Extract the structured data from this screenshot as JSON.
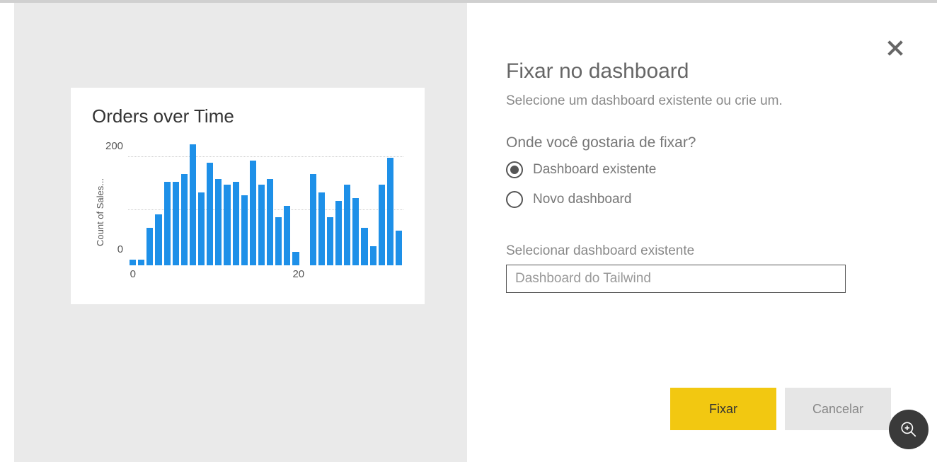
{
  "chart": {
    "title": "Orders over Time",
    "ylabel": "Count of Sales...",
    "yticks": [
      "200",
      "0"
    ],
    "xticks": [
      {
        "label": "0",
        "pos_pct": 2
      },
      {
        "label": "20",
        "pos_pct": 62
      }
    ]
  },
  "chart_data": {
    "type": "bar",
    "title": "Orders over Time",
    "xlabel": "",
    "ylabel": "Count of Sales...",
    "ylim": [
      0,
      230
    ],
    "yticks": [
      0,
      200
    ],
    "x": [
      0,
      1,
      2,
      3,
      4,
      5,
      6,
      7,
      8,
      9,
      10,
      11,
      12,
      13,
      14,
      15,
      16,
      17,
      18,
      19,
      20,
      21,
      22,
      23,
      24,
      25,
      26,
      27,
      28,
      29,
      30,
      31
    ],
    "values": [
      10,
      10,
      70,
      95,
      155,
      155,
      170,
      225,
      135,
      190,
      160,
      150,
      155,
      130,
      195,
      150,
      160,
      90,
      110,
      25,
      0,
      170,
      135,
      90,
      120,
      150,
      125,
      70,
      35,
      150,
      200,
      65
    ]
  },
  "dialog": {
    "title": "Fixar no dashboard",
    "subtitle": "Selecione um dashboard existente ou crie um.",
    "question": "Onde você gostaria de fixar?",
    "radio_existing": "Dashboard existente",
    "radio_new": "Novo dashboard",
    "select_label": "Selecionar dashboard existente",
    "select_value": "Dashboard do Tailwind",
    "btn_pin": "Fixar",
    "btn_cancel": "Cancelar"
  }
}
